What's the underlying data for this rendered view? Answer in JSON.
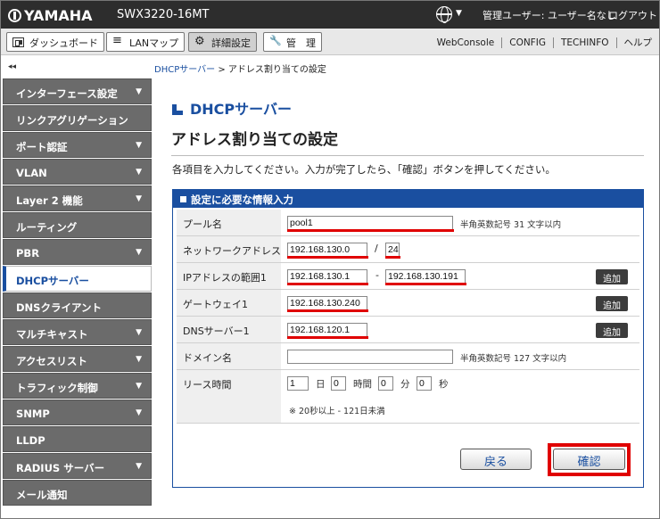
{
  "header": {
    "brand": "YAMAHA",
    "model": "SWX3220-16MT",
    "user": "管理ユーザー: ユーザー名なし",
    "logout": "ログアウト"
  },
  "tabs": [
    {
      "label": "ダッシュボード",
      "icon": "dashboard-icon"
    },
    {
      "label": "LANマップ",
      "icon": "lan-map-icon"
    },
    {
      "label": "詳細設定",
      "icon": "gear-icon",
      "active": true
    },
    {
      "label": "管　理",
      "icon": "wrench-icon"
    }
  ],
  "top_links": [
    "WebConsole",
    "CONFIG",
    "TECHINFO",
    "ヘルプ"
  ],
  "breadcrumb": {
    "parent": "DHCPサーバー",
    "separator": " > ",
    "current": "アドレス割り当ての設定"
  },
  "sidebar": {
    "collapse_glyph": "◂◂",
    "items": [
      {
        "label": "インターフェース設定",
        "arrow": "▼"
      },
      {
        "label": "リンクアグリゲーション",
        "arrow": ""
      },
      {
        "label": "ポート認証",
        "arrow": "▼"
      },
      {
        "label": "VLAN",
        "arrow": "▼"
      },
      {
        "label": "Layer 2 機能",
        "arrow": "▼"
      },
      {
        "label": "ルーティング",
        "arrow": ""
      },
      {
        "label": "PBR",
        "arrow": "▼"
      },
      {
        "label": "DHCPサーバー",
        "arrow": "",
        "active": true
      },
      {
        "label": "DNSクライアント",
        "arrow": ""
      },
      {
        "label": "マルチキャスト",
        "arrow": "▼"
      },
      {
        "label": "アクセスリスト",
        "arrow": "▼"
      },
      {
        "label": "トラフィック制御",
        "arrow": "▼"
      },
      {
        "label": "SNMP",
        "arrow": "▼"
      },
      {
        "label": "LLDP",
        "arrow": ""
      },
      {
        "label": "RADIUS サーバー",
        "arrow": "▼"
      },
      {
        "label": "メール通知",
        "arrow": ""
      }
    ]
  },
  "main": {
    "section": "DHCPサーバー",
    "title": "アドレス割り当ての設定",
    "description": "各項目を入力してください。入力が完了したら、「確認」ボタンを押してください。",
    "panel_title": "設定に必要な情報入力",
    "fields": {
      "pool_name": {
        "label": "プール名",
        "value": "pool1",
        "note": "半角英数記号 31 文字以内"
      },
      "network": {
        "label": "ネットワークアドレス",
        "address": "192.168.130.0",
        "separator": "/",
        "prefix": "24"
      },
      "range": {
        "label": "IPアドレスの範囲1",
        "start": "192.168.130.1",
        "separator": "-",
        "end": "192.168.130.191",
        "add": "追加"
      },
      "gateway": {
        "label": "ゲートウェイ1",
        "value": "192.168.130.240",
        "add": "追加"
      },
      "dns": {
        "label": "DNSサーバー1",
        "value": "192.168.120.1",
        "add": "追加"
      },
      "domain": {
        "label": "ドメイン名",
        "value": "",
        "note": "半角英数記号 127 文字以内"
      },
      "lease": {
        "label": "リース時間",
        "days": "1",
        "days_unit": "日",
        "hours": "0",
        "hours_unit": "時間",
        "minutes": "0",
        "minutes_unit": "分",
        "seconds": "0",
        "seconds_unit": "秒",
        "note": "※ 20秒以上 - 121日未満"
      }
    },
    "back_button": "戻る",
    "confirm_button": "確認",
    "highlight_color": "#e00000"
  }
}
